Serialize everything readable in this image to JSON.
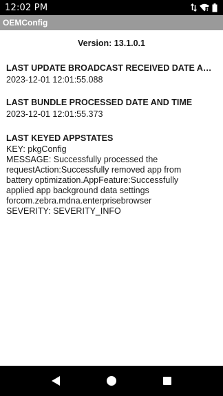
{
  "status_bar": {
    "time": "12:02 PM",
    "icons": [
      "data-transfer-icon",
      "wifi-icon",
      "battery-icon"
    ]
  },
  "app_bar": {
    "title": "OEMConfig"
  },
  "main": {
    "version": "Version: 13.1.0.1",
    "sections": [
      {
        "title": "LAST UPDATE BROADCAST RECEIVED DATE AND TIME",
        "value": "2023-12-01 12:01:55.088"
      },
      {
        "title": "LAST BUNDLE PROCESSED DATE AND TIME",
        "value": "2023-12-01 12:01:55.373"
      },
      {
        "title": "LAST KEYED APPSTATES",
        "lines": [
          "KEY: pkgConfig",
          "MESSAGE: Successfully processed the",
          "requestAction:Successfully removed app from",
          "battery optimization.AppFeature:Successfully",
          "applied app background data settings",
          "forcom.zebra.mdna.enterprisebrowser",
          "SEVERITY: SEVERITY_INFO"
        ]
      }
    ]
  },
  "nav_bar": {
    "buttons": [
      "back-icon",
      "home-icon",
      "recents-icon"
    ]
  },
  "colors": {
    "status_bar": "#000000",
    "app_bar": "#9a9a9a",
    "background": "#ffffff",
    "text": "#1a1a1a"
  }
}
